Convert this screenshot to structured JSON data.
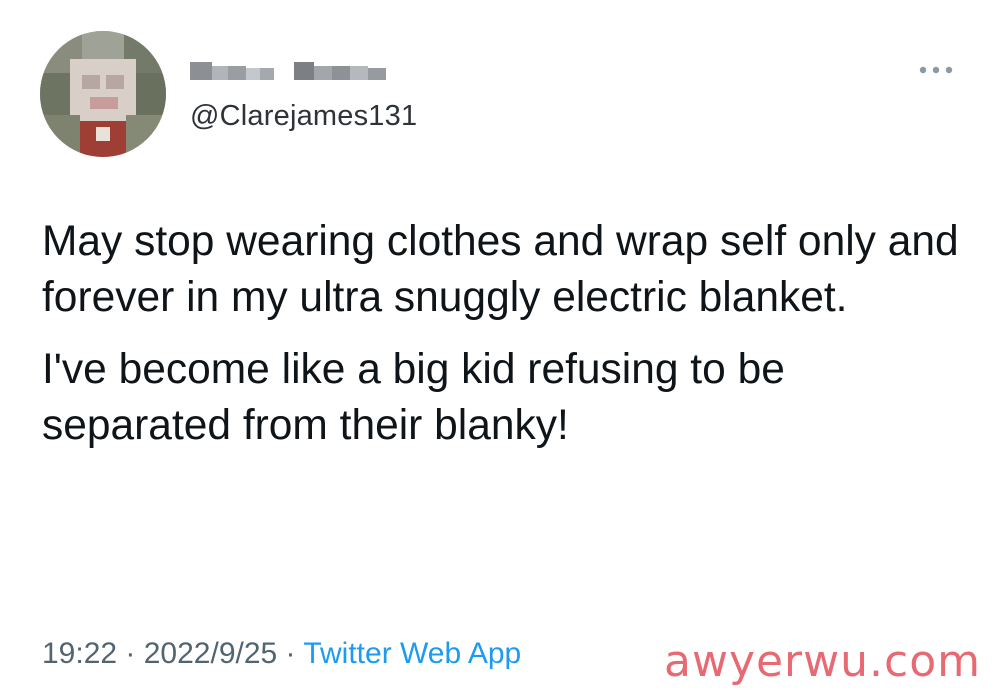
{
  "tweet": {
    "handle": "@Clarejames131",
    "text_paragraphs": [
      "May stop wearing clothes and wrap self only and forever in my ultra snuggly electric blanket.",
      "I've become like a big kid refusing to be separated from their blanky!"
    ],
    "time": "19:22",
    "separator": " · ",
    "date": "2022/9/25",
    "source": "Twitter Web App",
    "more_icon": "more-horizontal-icon",
    "avatar_icon": "blurred-avatar",
    "display_name_icon": "redacted-display-name"
  },
  "watermark": "awyerwu.com",
  "colors": {
    "text": "#0f1419",
    "muted": "#536471",
    "link": "#1d9bf0",
    "watermark": "#e6636c"
  }
}
